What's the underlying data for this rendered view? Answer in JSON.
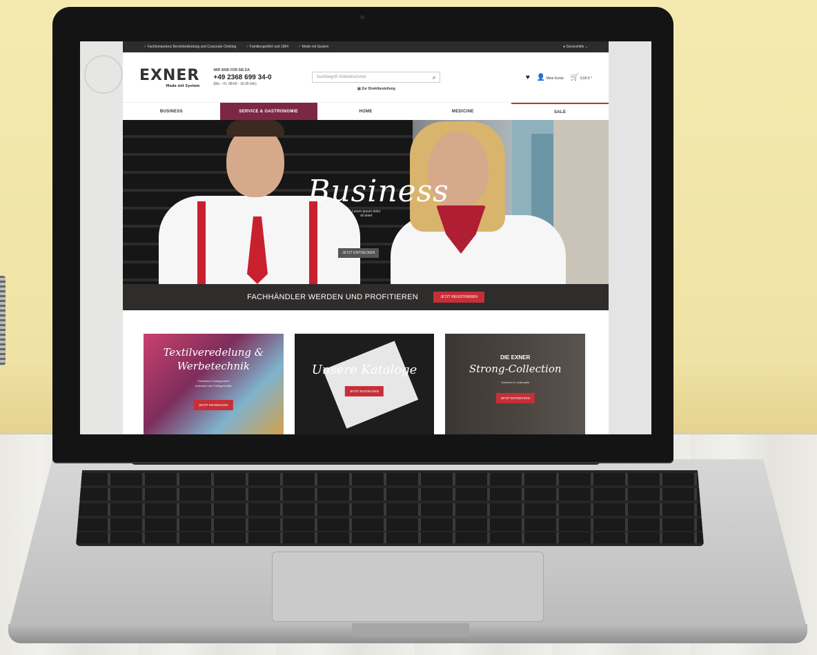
{
  "topbar": {
    "items": [
      "Fachkompetenz Berufsbekleidung und Corporate Clothing",
      "Familiengeführt seit 1864",
      "Mode mit System"
    ],
    "service": "Servicehilfe"
  },
  "header": {
    "logo_text": "EXNER",
    "logo_tagline": "Mode mit System",
    "contact_heading": "WIR SIND FÜR SIE DA",
    "phone": "+49 2368 699 34-0",
    "hours": "(Mo. - Fr. 08:00 - 16:30 Uhr)",
    "search_placeholder": "Suchbegriff /Artikelnummer",
    "direct_order": "Zur Direktbestellung",
    "account": "Mein Konto",
    "cart_total": "0,00 € *"
  },
  "nav": {
    "items": [
      "BUSINESS",
      "SERVICE & GASTRONOMIE",
      "HOME",
      "MEDICINE",
      "SALE"
    ]
  },
  "hero": {
    "title": "Business",
    "subtitle_1": "Lorem ipsum dolor",
    "subtitle_2": "sit amet",
    "button": "JETZT ENTDECKEN"
  },
  "promo": {
    "text": "FACHHÄNDLER WERDEN UND PROFITIEREN",
    "button": "JETZT REGISTRIEREN"
  },
  "tiles": [
    {
      "title_line1": "Textilveredelung &",
      "title_line2": "Werbetechnik",
      "sub_1": "Persönlich & kategorisiert",
      "sub_2": "verändern des Pullingeschäfts",
      "button": "JETZT ENTDECKEN"
    },
    {
      "title": "Unsere Kataloge",
      "button": "JETZT ENTDECKEN"
    },
    {
      "caption": "DIE EXNER",
      "title": "Strong-Collection",
      "sub": "Schürzen in Lederoptik",
      "button": "JETZT ENTDECKEN"
    }
  ],
  "colors": {
    "accent": "#c62f37",
    "nav_active": "#7d2746",
    "wall": "#f4eab0"
  }
}
